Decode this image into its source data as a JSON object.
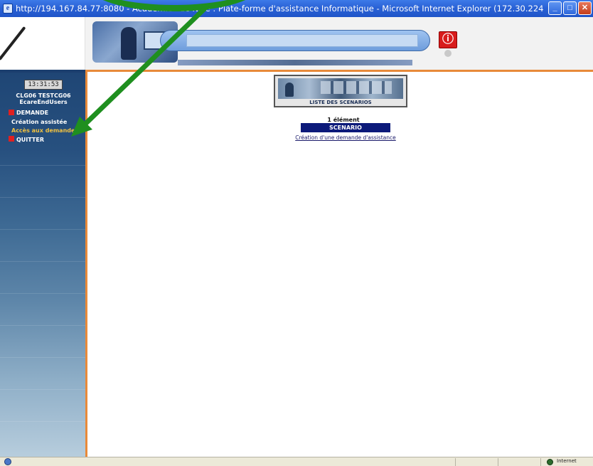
{
  "window": {
    "title": "http://194.167.84.77:8080 - Académies de Nice : Plate-forme d'assistance Informatique - Microsoft Internet Explorer (172.30.224",
    "minimize_label": "_",
    "maximize_label": "□",
    "close_label": "✕"
  },
  "header": {
    "info_icon_glyph": "ⓘ"
  },
  "sidebar": {
    "clock": "13:31:53",
    "user_line1": "CLG06 TESTCG06",
    "user_line2": "EcareEndUsers",
    "menu": [
      {
        "label": "DEMANDE",
        "sub": [
          {
            "label": "Création assistée"
          },
          {
            "label": "Accès aux demandes",
            "active": true
          }
        ]
      },
      {
        "label": "QUITTER",
        "sub": []
      }
    ]
  },
  "main": {
    "banner_caption": "LISTE DES SCENARIOS",
    "element_count": "1 élément",
    "column_header": "SCENARIO",
    "rows": [
      {
        "label": "Création d'une demande d'assistance"
      }
    ]
  },
  "statusbar": {
    "zone": "Internet"
  },
  "colors": {
    "annotation": "#1f8f1f",
    "accent_orange": "#e88a3a",
    "menu_bullet": "#e02020",
    "active_menu": "#f0c040"
  }
}
